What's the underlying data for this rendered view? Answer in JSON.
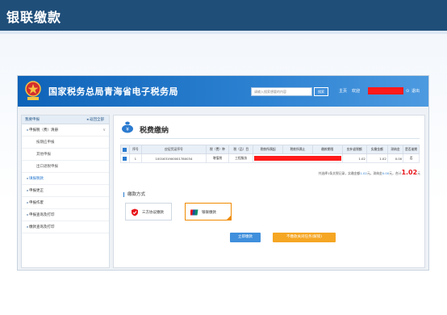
{
  "slide": {
    "title": "银联缴款"
  },
  "app": {
    "title": "国家税务总局青海省电子税务局",
    "search_placeholder": "请输入搜索想要的内容",
    "search_button": "搜索",
    "home_link": "主页",
    "welcome_link": "欢迎",
    "logout_link": "退出"
  },
  "sidebar": {
    "header_left": "我要申报",
    "header_right": "返回全部",
    "items": [
      {
        "label": "申报税（费）清册"
      },
      {
        "label": "按期应申报"
      },
      {
        "label": "其他申报"
      },
      {
        "label": "出口退税申报"
      },
      {
        "label": "填报税款"
      },
      {
        "label": "申报更正"
      },
      {
        "label": "申报作废"
      },
      {
        "label": "申报查询及打印"
      },
      {
        "label": "缴款查询及打印"
      }
    ]
  },
  "main": {
    "title": "税费缴纳",
    "table": {
      "headers": [
        "序号",
        "应征凭证序号",
        "税（费）种",
        "税（品）目",
        "税款所属起",
        "税款所属止",
        "缴款期限",
        "应补退税额",
        "实缴金额",
        "滞纳金",
        "是否逾期"
      ],
      "rows": [
        {
          "index": "1",
          "voucher": "1001631900001780034",
          "tax_type": "增值税",
          "item": "工程服务",
          "amount_due": "1.02",
          "amount_paid": "1.02",
          "late_fee": "0.00",
          "overdue": "否"
        }
      ]
    },
    "summary": {
      "text1": "共选择1条文税记录，实缴金额",
      "paid": "1.02",
      "text2": "元，滞纳金",
      "late": "0.00",
      "text3": "元，合计",
      "total": "1.02",
      "unit": "元"
    },
    "payment": {
      "label": "缴款方式",
      "options": [
        {
          "label": "三方协议缴款",
          "selected": false
        },
        {
          "label": "银联缴款",
          "selected": true
        }
      ]
    },
    "buttons": {
      "pay_now": "立即缴款",
      "submit_later": "不缴款关闭任务(解锁)"
    }
  },
  "colors": {
    "header_blue": "#0e63b8",
    "slide_header": "#1f4e79",
    "accent_blue": "#2b7bd0",
    "orange": "#f5a623",
    "redaction": "#ff1a1a",
    "total_red": "#e8151b"
  }
}
